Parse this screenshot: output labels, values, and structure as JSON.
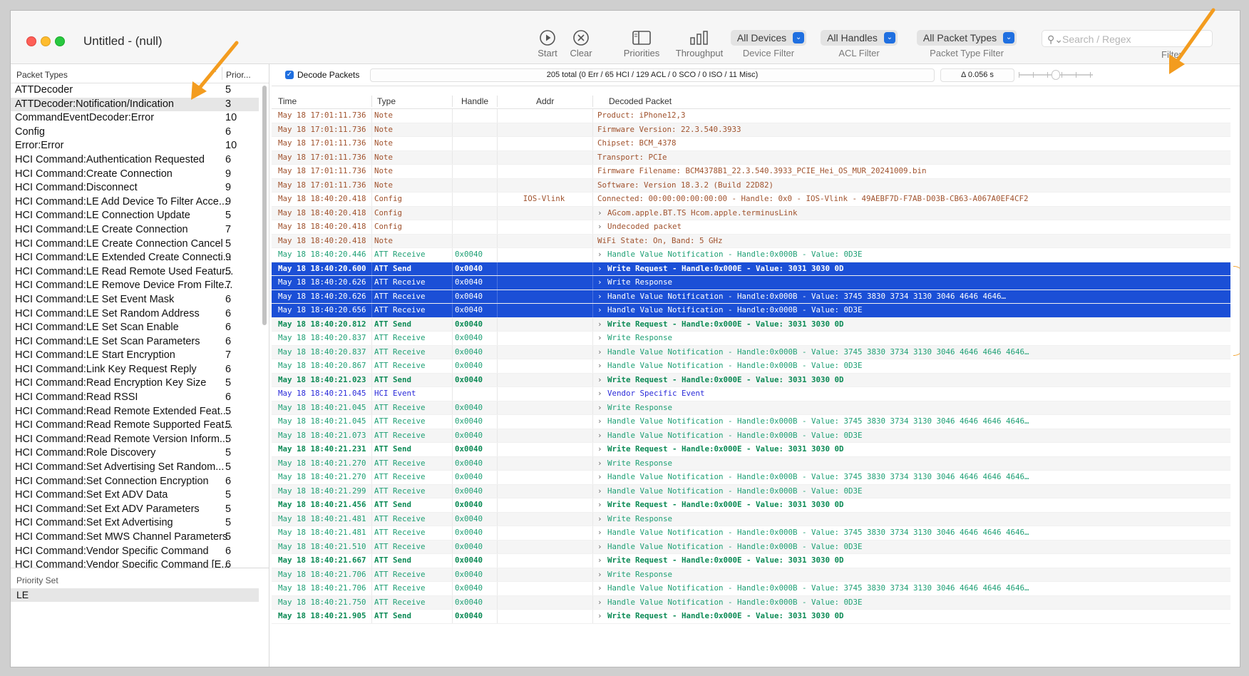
{
  "window": {
    "title": "Untitled - (null)"
  },
  "toolbar": {
    "start_label": "Start",
    "clear_label": "Clear",
    "priorities_label": "Priorities",
    "throughput_label": "Throughput",
    "device_filter_value": "All Devices",
    "device_filter_caption": "Device Filter",
    "acl_filter_value": "All Handles",
    "acl_filter_caption": "ACL Filter",
    "packet_type_filter_value": "All Packet Types",
    "packet_type_filter_caption": "Packet Type Filter",
    "search_placeholder": "Search / Regex",
    "filter_caption": "Filter"
  },
  "sidebar": {
    "header_packet_types": "Packet Types",
    "header_priority": "Prior...",
    "items": [
      {
        "name": "ATTDecoder",
        "priority": "5"
      },
      {
        "name": "ATTDecoder:Notification/Indication",
        "priority": "3",
        "selected": true
      },
      {
        "name": "CommandEventDecoder:Error",
        "priority": "10"
      },
      {
        "name": "Config",
        "priority": "6"
      },
      {
        "name": "Error:Error",
        "priority": "10"
      },
      {
        "name": "HCI Command:Authentication Requested",
        "priority": "6"
      },
      {
        "name": "HCI Command:Create Connection",
        "priority": "9"
      },
      {
        "name": "HCI Command:Disconnect",
        "priority": "9"
      },
      {
        "name": "HCI Command:LE Add Device To Filter Acce...",
        "priority": "9"
      },
      {
        "name": "HCI Command:LE Connection Update",
        "priority": "5"
      },
      {
        "name": "HCI Command:LE Create Connection",
        "priority": "7"
      },
      {
        "name": "HCI Command:LE Create Connection Cancel",
        "priority": "5"
      },
      {
        "name": "HCI Command:LE Extended Create Connecti...",
        "priority": "9"
      },
      {
        "name": "HCI Command:LE Read Remote Used Featur...",
        "priority": "5"
      },
      {
        "name": "HCI Command:LE Remove Device From Filte...",
        "priority": "7"
      },
      {
        "name": "HCI Command:LE Set Event Mask",
        "priority": "6"
      },
      {
        "name": "HCI Command:LE Set Random Address",
        "priority": "6"
      },
      {
        "name": "HCI Command:LE Set Scan Enable",
        "priority": "6"
      },
      {
        "name": "HCI Command:LE Set Scan Parameters",
        "priority": "6"
      },
      {
        "name": "HCI Command:LE Start Encryption",
        "priority": "7"
      },
      {
        "name": "HCI Command:Link Key Request Reply",
        "priority": "6"
      },
      {
        "name": "HCI Command:Read Encryption Key Size",
        "priority": "5"
      },
      {
        "name": "HCI Command:Read RSSI",
        "priority": "6"
      },
      {
        "name": "HCI Command:Read Remote Extended Feat...",
        "priority": "5"
      },
      {
        "name": "HCI Command:Read Remote Supported Feat...",
        "priority": "5"
      },
      {
        "name": "HCI Command:Read Remote Version Inform...",
        "priority": "5"
      },
      {
        "name": "HCI Command:Role Discovery",
        "priority": "5"
      },
      {
        "name": "HCI Command:Set Advertising Set Random...",
        "priority": "5"
      },
      {
        "name": "HCI Command:Set Connection Encryption",
        "priority": "6"
      },
      {
        "name": "HCI Command:Set Ext ADV Data",
        "priority": "5"
      },
      {
        "name": "HCI Command:Set Ext ADV Parameters",
        "priority": "5"
      },
      {
        "name": "HCI Command:Set Ext Advertising",
        "priority": "5"
      },
      {
        "name": "HCI Command:Set MWS Channel Parameters",
        "priority": "5"
      },
      {
        "name": "HCI Command:Vendor Specific Command",
        "priority": "6"
      },
      {
        "name": "HCI Command:Vendor Specific Command [E...",
        "priority": "6"
      }
    ]
  },
  "priority_set": {
    "header": "Priority Set",
    "value": "LE"
  },
  "options": {
    "decode_label": "Decode Packets",
    "summary": "205 total (0 Err / 65 HCI / 129 ACL / 0 SCO / 0 ISO / 11 Misc)",
    "delta": "Δ 0.056 s"
  },
  "table": {
    "headers": {
      "time": "Time",
      "type": "Type",
      "handle": "Handle",
      "addr": "Addr",
      "decoded": "Decoded Packet"
    },
    "rows": [
      {
        "time": "May 18 17:01:11.736",
        "type": "Note",
        "handle": "",
        "addr": "",
        "decoded": "Product: iPhone12,3",
        "kind": "note",
        "chevron": false
      },
      {
        "time": "May 18 17:01:11.736",
        "type": "Note",
        "handle": "",
        "addr": "",
        "decoded": "Firmware Version: 22.3.540.3933",
        "kind": "note",
        "chevron": false
      },
      {
        "time": "May 18 17:01:11.736",
        "type": "Note",
        "handle": "",
        "addr": "",
        "decoded": "Chipset: BCM_4378",
        "kind": "note",
        "chevron": false
      },
      {
        "time": "May 18 17:01:11.736",
        "type": "Note",
        "handle": "",
        "addr": "",
        "decoded": "Transport: PCIe",
        "kind": "note",
        "chevron": false
      },
      {
        "time": "May 18 17:01:11.736",
        "type": "Note",
        "handle": "",
        "addr": "",
        "decoded": "Firmware Filename: BCM4378B1_22.3.540.3933_PCIE_Hei_OS_MUR_20241009.bin",
        "kind": "note",
        "chevron": false
      },
      {
        "time": "May 18 17:01:11.736",
        "type": "Note",
        "handle": "",
        "addr": "",
        "decoded": "Software: Version 18.3.2 (Build 22D82)",
        "kind": "note",
        "chevron": false
      },
      {
        "time": "May 18 18:40:20.418",
        "type": "Config",
        "handle": "",
        "addr": "IOS-Vlink",
        "decoded": "Connected: 00:00:00:00:00:00 - Handle: 0x0 - IOS-Vlink - 49AEBF7D-F7AB-D03B-CB63-A067A0EF4CF2",
        "kind": "note",
        "chevron": false
      },
      {
        "time": "May 18 18:40:20.418",
        "type": "Config",
        "handle": "",
        "addr": "",
        "decoded": "AGcom.apple.BT.TS    Hcom.apple.terminusLink",
        "kind": "note",
        "chevron": true
      },
      {
        "time": "May 18 18:40:20.418",
        "type": "Config",
        "handle": "",
        "addr": "",
        "decoded": "Undecoded packet",
        "kind": "note",
        "chevron": true
      },
      {
        "time": "May 18 18:40:20.418",
        "type": "Note",
        "handle": "",
        "addr": "",
        "decoded": "WiFi State: On, Band: 5 GHz",
        "kind": "note",
        "chevron": false
      },
      {
        "time": "May 18 18:40:20.446",
        "type": "ATT Receive",
        "handle": "0x0040",
        "addr": "",
        "decoded": "Handle Value Notification - Handle:0x000B - Value: 0D3E",
        "kind": "recv",
        "chevron": true
      },
      {
        "time": "May 18 18:40:20.600",
        "type": "ATT Send",
        "handle": "0x0040",
        "addr": "",
        "decoded": "Write Request - Handle:0x000E - Value: 3031 3030 0D",
        "kind": "send",
        "chevron": true,
        "selected": true
      },
      {
        "time": "May 18 18:40:20.626",
        "type": "ATT Receive",
        "handle": "0x0040",
        "addr": "",
        "decoded": "Write Response",
        "kind": "recv",
        "chevron": true,
        "selected": true
      },
      {
        "time": "May 18 18:40:20.626",
        "type": "ATT Receive",
        "handle": "0x0040",
        "addr": "",
        "decoded": "Handle Value Notification - Handle:0x000B - Value: 3745 3830 3734 3130 3046 4646 4646…",
        "kind": "recv",
        "chevron": true,
        "selected": true
      },
      {
        "time": "May 18 18:40:20.656",
        "type": "ATT Receive",
        "handle": "0x0040",
        "addr": "",
        "decoded": "Handle Value Notification - Handle:0x000B - Value: 0D3E",
        "kind": "recv",
        "chevron": true,
        "selected": true
      },
      {
        "time": "May 18 18:40:20.812",
        "type": "ATT Send",
        "handle": "0x0040",
        "addr": "",
        "decoded": "Write Request - Handle:0x000E - Value: 3031 3030 0D",
        "kind": "send",
        "chevron": true
      },
      {
        "time": "May 18 18:40:20.837",
        "type": "ATT Receive",
        "handle": "0x0040",
        "addr": "",
        "decoded": "Write Response",
        "kind": "recv",
        "chevron": true
      },
      {
        "time": "May 18 18:40:20.837",
        "type": "ATT Receive",
        "handle": "0x0040",
        "addr": "",
        "decoded": "Handle Value Notification - Handle:0x000B - Value: 3745 3830 3734 3130 3046 4646 4646 4646…",
        "kind": "recv",
        "chevron": true
      },
      {
        "time": "May 18 18:40:20.867",
        "type": "ATT Receive",
        "handle": "0x0040",
        "addr": "",
        "decoded": "Handle Value Notification - Handle:0x000B - Value: 0D3E",
        "kind": "recv",
        "chevron": true
      },
      {
        "time": "May 18 18:40:21.023",
        "type": "ATT Send",
        "handle": "0x0040",
        "addr": "",
        "decoded": "Write Request - Handle:0x000E - Value: 3031 3030 0D",
        "kind": "send",
        "chevron": true
      },
      {
        "time": "May 18 18:40:21.045",
        "type": "HCI Event",
        "handle": "",
        "addr": "",
        "decoded": "Vendor Specific Event",
        "kind": "hci",
        "chevron": true
      },
      {
        "time": "May 18 18:40:21.045",
        "type": "ATT Receive",
        "handle": "0x0040",
        "addr": "",
        "decoded": "Write Response",
        "kind": "recv",
        "chevron": true
      },
      {
        "time": "May 18 18:40:21.045",
        "type": "ATT Receive",
        "handle": "0x0040",
        "addr": "",
        "decoded": "Handle Value Notification - Handle:0x000B - Value: 3745 3830 3734 3130 3046 4646 4646 4646…",
        "kind": "recv",
        "chevron": true
      },
      {
        "time": "May 18 18:40:21.073",
        "type": "ATT Receive",
        "handle": "0x0040",
        "addr": "",
        "decoded": "Handle Value Notification - Handle:0x000B - Value: 0D3E",
        "kind": "recv",
        "chevron": true
      },
      {
        "time": "May 18 18:40:21.231",
        "type": "ATT Send",
        "handle": "0x0040",
        "addr": "",
        "decoded": "Write Request - Handle:0x000E - Value: 3031 3030 0D",
        "kind": "send",
        "chevron": true
      },
      {
        "time": "May 18 18:40:21.270",
        "type": "ATT Receive",
        "handle": "0x0040",
        "addr": "",
        "decoded": "Write Response",
        "kind": "recv",
        "chevron": true
      },
      {
        "time": "May 18 18:40:21.270",
        "type": "ATT Receive",
        "handle": "0x0040",
        "addr": "",
        "decoded": "Handle Value Notification - Handle:0x000B - Value: 3745 3830 3734 3130 3046 4646 4646 4646…",
        "kind": "recv",
        "chevron": true
      },
      {
        "time": "May 18 18:40:21.299",
        "type": "ATT Receive",
        "handle": "0x0040",
        "addr": "",
        "decoded": "Handle Value Notification - Handle:0x000B - Value: 0D3E",
        "kind": "recv",
        "chevron": true
      },
      {
        "time": "May 18 18:40:21.456",
        "type": "ATT Send",
        "handle": "0x0040",
        "addr": "",
        "decoded": "Write Request - Handle:0x000E - Value: 3031 3030 0D",
        "kind": "send",
        "chevron": true
      },
      {
        "time": "May 18 18:40:21.481",
        "type": "ATT Receive",
        "handle": "0x0040",
        "addr": "",
        "decoded": "Write Response",
        "kind": "recv",
        "chevron": true
      },
      {
        "time": "May 18 18:40:21.481",
        "type": "ATT Receive",
        "handle": "0x0040",
        "addr": "",
        "decoded": "Handle Value Notification - Handle:0x000B - Value: 3745 3830 3734 3130 3046 4646 4646 4646…",
        "kind": "recv",
        "chevron": true
      },
      {
        "time": "May 18 18:40:21.510",
        "type": "ATT Receive",
        "handle": "0x0040",
        "addr": "",
        "decoded": "Handle Value Notification - Handle:0x000B - Value: 0D3E",
        "kind": "recv",
        "chevron": true
      },
      {
        "time": "May 18 18:40:21.667",
        "type": "ATT Send",
        "handle": "0x0040",
        "addr": "",
        "decoded": "Write Request - Handle:0x000E - Value: 3031 3030 0D",
        "kind": "send",
        "chevron": true
      },
      {
        "time": "May 18 18:40:21.706",
        "type": "ATT Receive",
        "handle": "0x0040",
        "addr": "",
        "decoded": "Write Response",
        "kind": "recv",
        "chevron": true
      },
      {
        "time": "May 18 18:40:21.706",
        "type": "ATT Receive",
        "handle": "0x0040",
        "addr": "",
        "decoded": "Handle Value Notification - Handle:0x000B - Value: 3745 3830 3734 3130 3046 4646 4646 4646…",
        "kind": "recv",
        "chevron": true
      },
      {
        "time": "May 18 18:40:21.750",
        "type": "ATT Receive",
        "handle": "0x0040",
        "addr": "",
        "decoded": "Handle Value Notification - Handle:0x000B - Value: 0D3E",
        "kind": "recv",
        "chevron": true
      },
      {
        "time": "May 18 18:40:21.905",
        "type": "ATT Send",
        "handle": "0x0040",
        "addr": "",
        "decoded": "Write Request - Handle:0x000E - Value: 3031 3030 0D",
        "kind": "send",
        "chevron": true
      }
    ]
  },
  "colors": {
    "note": "#a0522d",
    "recv": "#1fa075",
    "send": "#0b8a55",
    "hci": "#2b2bd9",
    "selection": "#1b4fd6",
    "annotation": "#f3a637"
  }
}
